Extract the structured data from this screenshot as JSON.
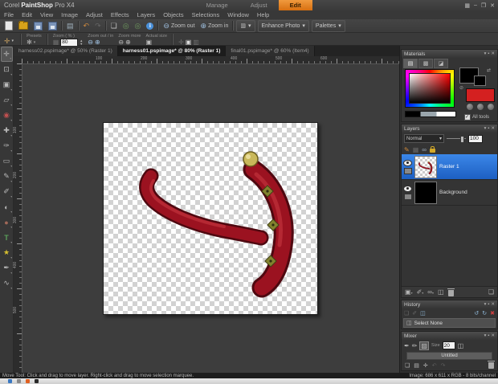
{
  "titlebar": {
    "app_prefix": "Corel ",
    "app_name": "PaintShop",
    "app_suffix": " Pro X4",
    "tabs": [
      {
        "label": "Manage"
      },
      {
        "label": "Adjust"
      },
      {
        "label": "Edit"
      }
    ],
    "workspace_icon": "▦",
    "minimize": "–",
    "restore": "❐",
    "close": "✕"
  },
  "menubar": {
    "items": [
      "File",
      "Edit",
      "View",
      "Image",
      "Adjust",
      "Effects",
      "Layers",
      "Objects",
      "Selections",
      "Window",
      "Help"
    ]
  },
  "toolbar": {
    "zoom_out_label": "Zoom out",
    "zoom_in_label": "Zoom in",
    "enhance_label": "Enhance Photo",
    "palettes_label": "Palettes",
    "undo_glyph": "↶",
    "redo_glyph": "↷",
    "find_glyph": "◎",
    "resize_glyph": "❏",
    "zoom_out_glyph": "⊖",
    "zoom_in_glyph": "⊕",
    "layout_glyph": "▥"
  },
  "tool_options": {
    "current_tool_glyph": "✛",
    "presets_label": "Presets",
    "presets_glyph": "✻",
    "zoom_pct_label": "Zoom ( % )",
    "zoom_value": "80",
    "zoom_out_in_label": "Zoom out / in",
    "zoom_more_label": "Zoom more",
    "actual_size_label": "Actual size",
    "actual_size_glyph": "▣"
  },
  "document_tabs": {
    "tabs": [
      {
        "title": "harness02.pspimage* @ 50% (Raster 1)",
        "active": false
      },
      {
        "title": "harness01.pspimage* @ 80% (Raster 1)",
        "active": true
      },
      {
        "title": "final01.pspimage* @ 60% (Item4)",
        "active": false
      }
    ]
  },
  "tools": {
    "items": [
      {
        "name": "move-tool",
        "glyph": "✛"
      },
      {
        "name": "selection-tool",
        "glyph": "⊡"
      },
      {
        "name": "crop-tool",
        "glyph": "▣"
      },
      {
        "name": "straighten-tool",
        "glyph": "▱"
      },
      {
        "name": "red-eye-tool",
        "glyph": "◉"
      },
      {
        "name": "makeover-tool",
        "glyph": "✚"
      },
      {
        "name": "clone-brush-tool",
        "glyph": "✑"
      },
      {
        "name": "scratch-remover-tool",
        "glyph": "▭"
      },
      {
        "name": "paint-brush-tool",
        "glyph": "✎"
      },
      {
        "name": "airbrush-tool",
        "glyph": "✐"
      },
      {
        "name": "lighten-darken-tool",
        "glyph": "◐"
      },
      {
        "name": "smudge-tool",
        "glyph": "●"
      },
      {
        "name": "text-tool",
        "glyph": "T"
      },
      {
        "name": "preset-shapes-tool",
        "glyph": "★"
      },
      {
        "name": "pen-tool",
        "glyph": "✒"
      },
      {
        "name": "warp-brush-tool",
        "glyph": "∿"
      }
    ]
  },
  "rulers": {
    "h": [
      "100",
      "200",
      "300",
      "400",
      "500",
      "600"
    ],
    "v": [
      "100",
      "200",
      "300",
      "400",
      "500"
    ]
  },
  "canvas": {
    "subject": "red leather harness strap with brass studs on transparent background",
    "strap_color": "#9b1220",
    "stud_color": "#82822e",
    "ball_color": "#c9b85a"
  },
  "materials": {
    "title": "Materials",
    "all_tools_label": "All tools",
    "foreground_color": "#000000",
    "background_color": "#000000",
    "fill_color": "#d42020"
  },
  "layers": {
    "title": "Layers",
    "blend_mode": "Normal",
    "opacity": "100",
    "rows": [
      {
        "name": "Raster 1",
        "selected": true
      },
      {
        "name": "Background",
        "selected": false
      }
    ]
  },
  "history": {
    "title": "History",
    "items": [
      {
        "label": "Select None"
      }
    ]
  },
  "mixer": {
    "title": "Mixer",
    "size_label": "Size",
    "size_value": "20",
    "page_name": "Untitled"
  },
  "status": {
    "hint": "Move Tool: Click and drag to move layer. Right-click and drag to move selection marquee.",
    "image_info": "Image:  686 x 611 x RGB - 8 bits/channel"
  },
  "ui": {
    "caret": "▾",
    "close": "✕",
    "pin": "▪"
  }
}
